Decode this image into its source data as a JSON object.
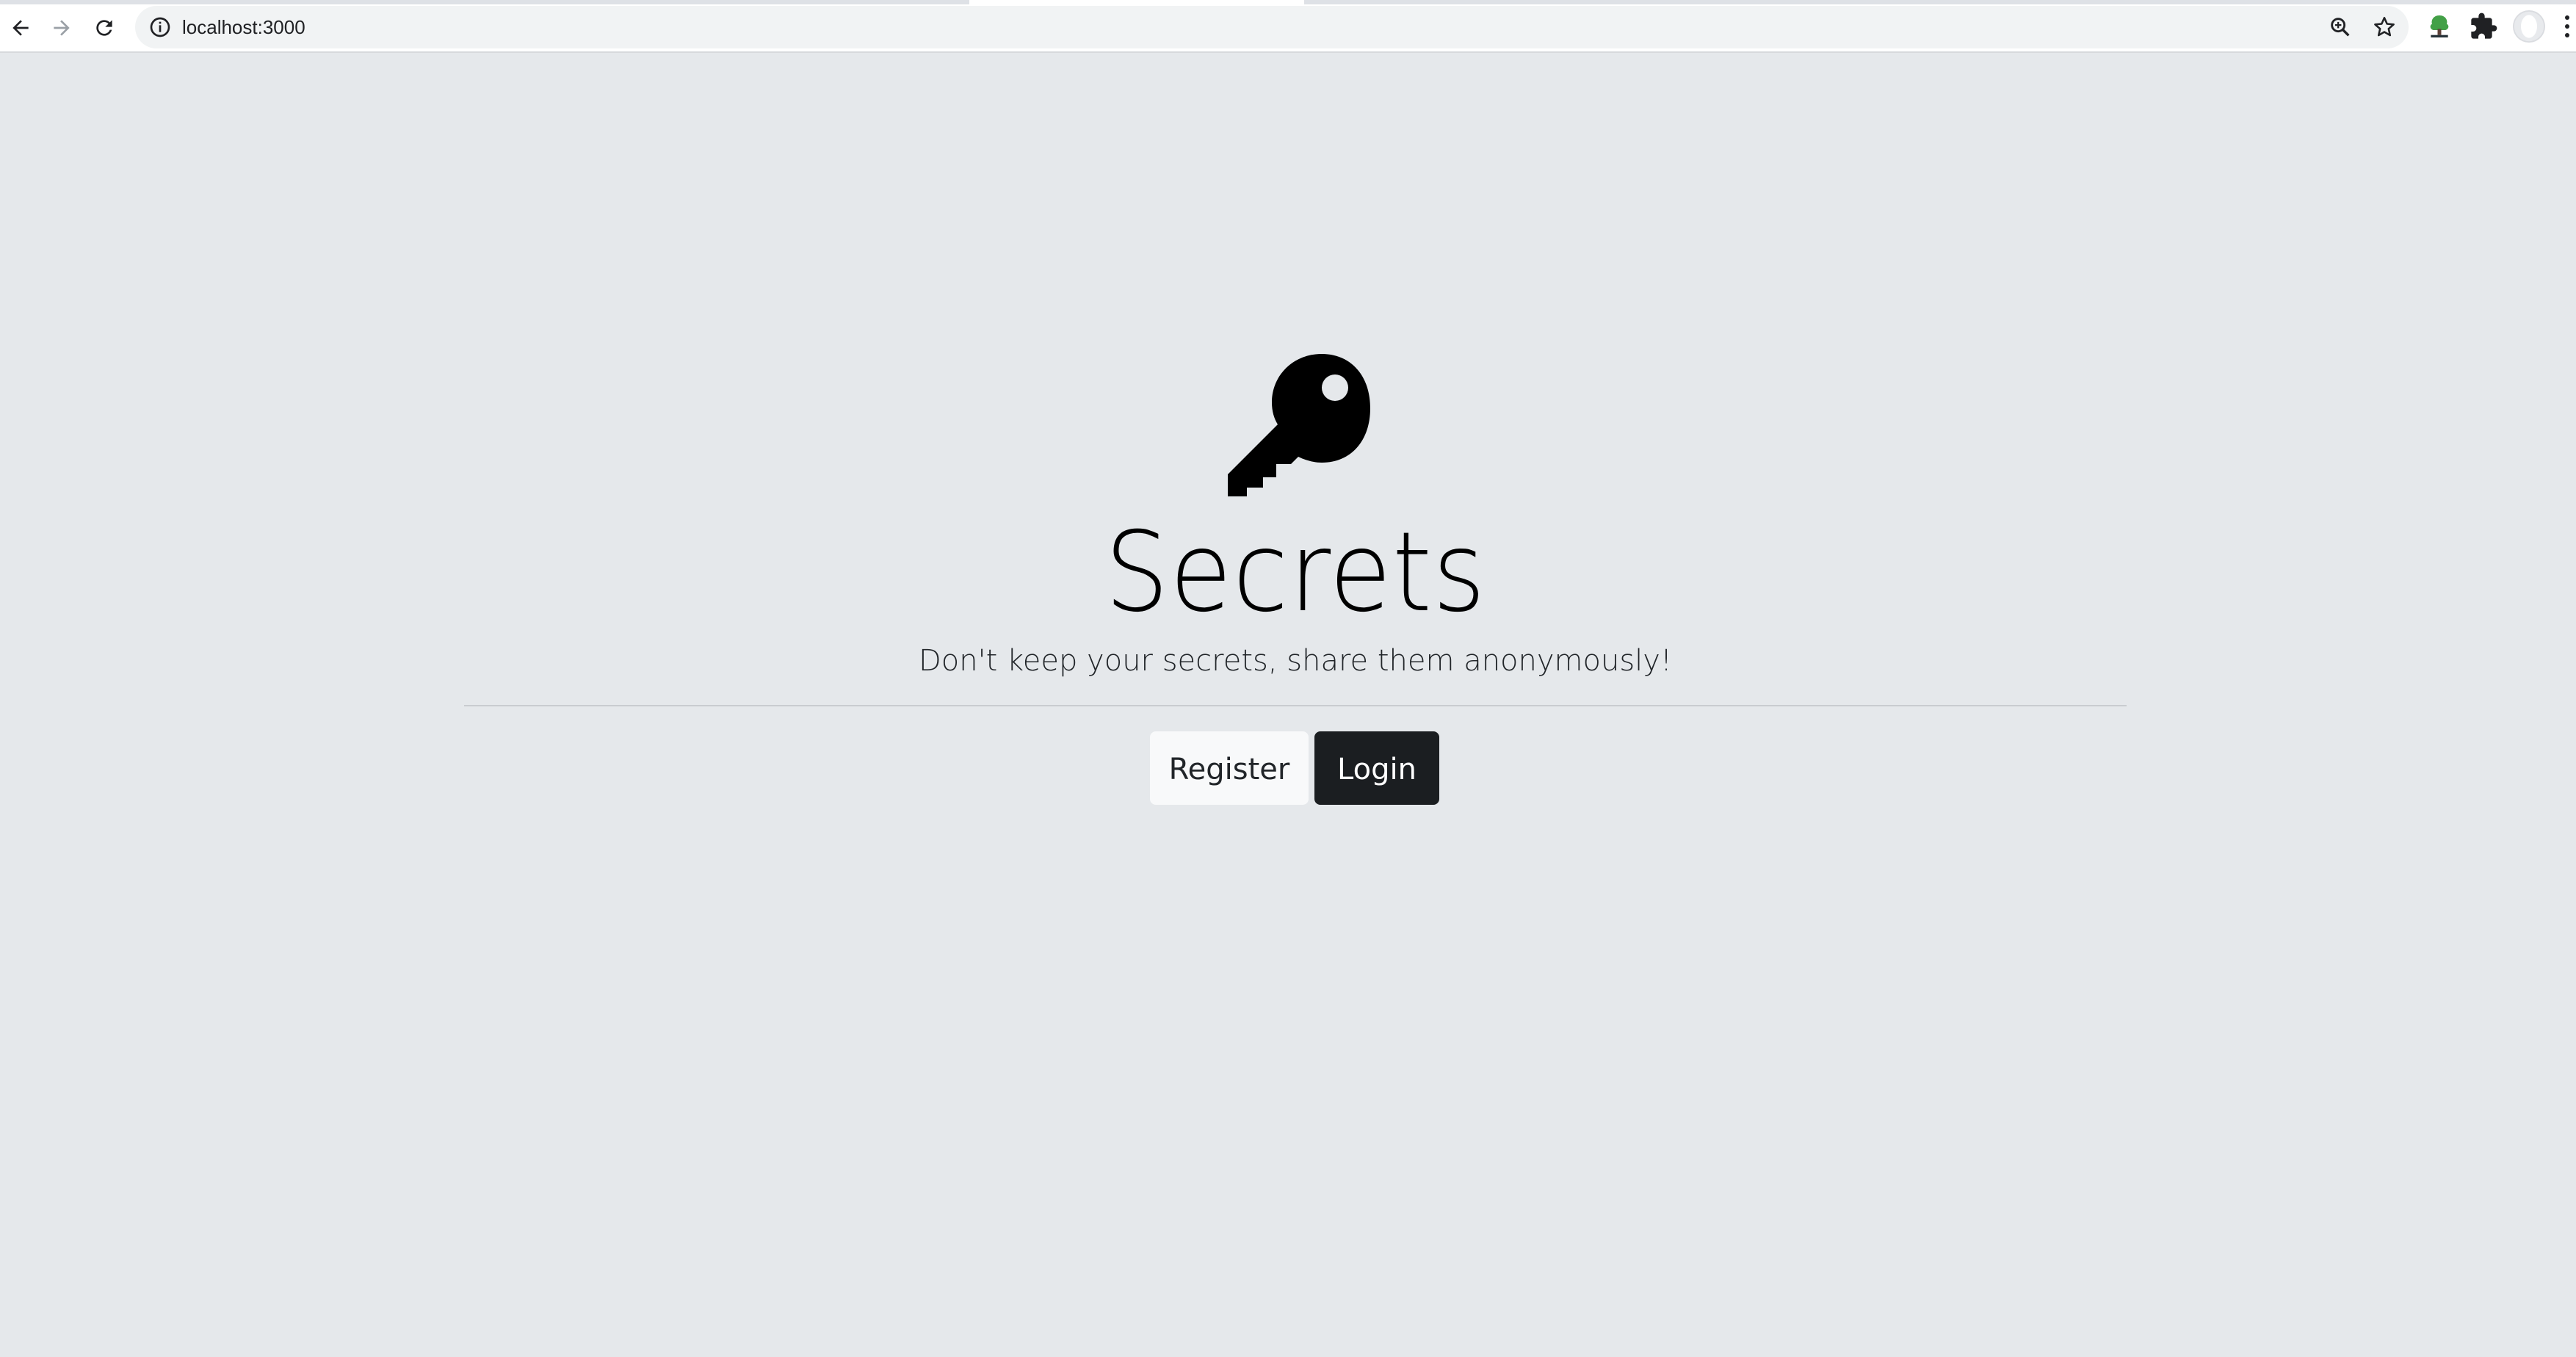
{
  "browser": {
    "url": "localhost:3000"
  },
  "hero": {
    "icon": "key-icon",
    "title": "Secrets",
    "lead": "Don't keep your secrets, share them anonymously!",
    "register_label": "Register",
    "login_label": "Login"
  },
  "colors": {
    "page_background": "#e5e8eb",
    "register_button": "#f8f9fa",
    "login_button": "#1b1e21"
  }
}
